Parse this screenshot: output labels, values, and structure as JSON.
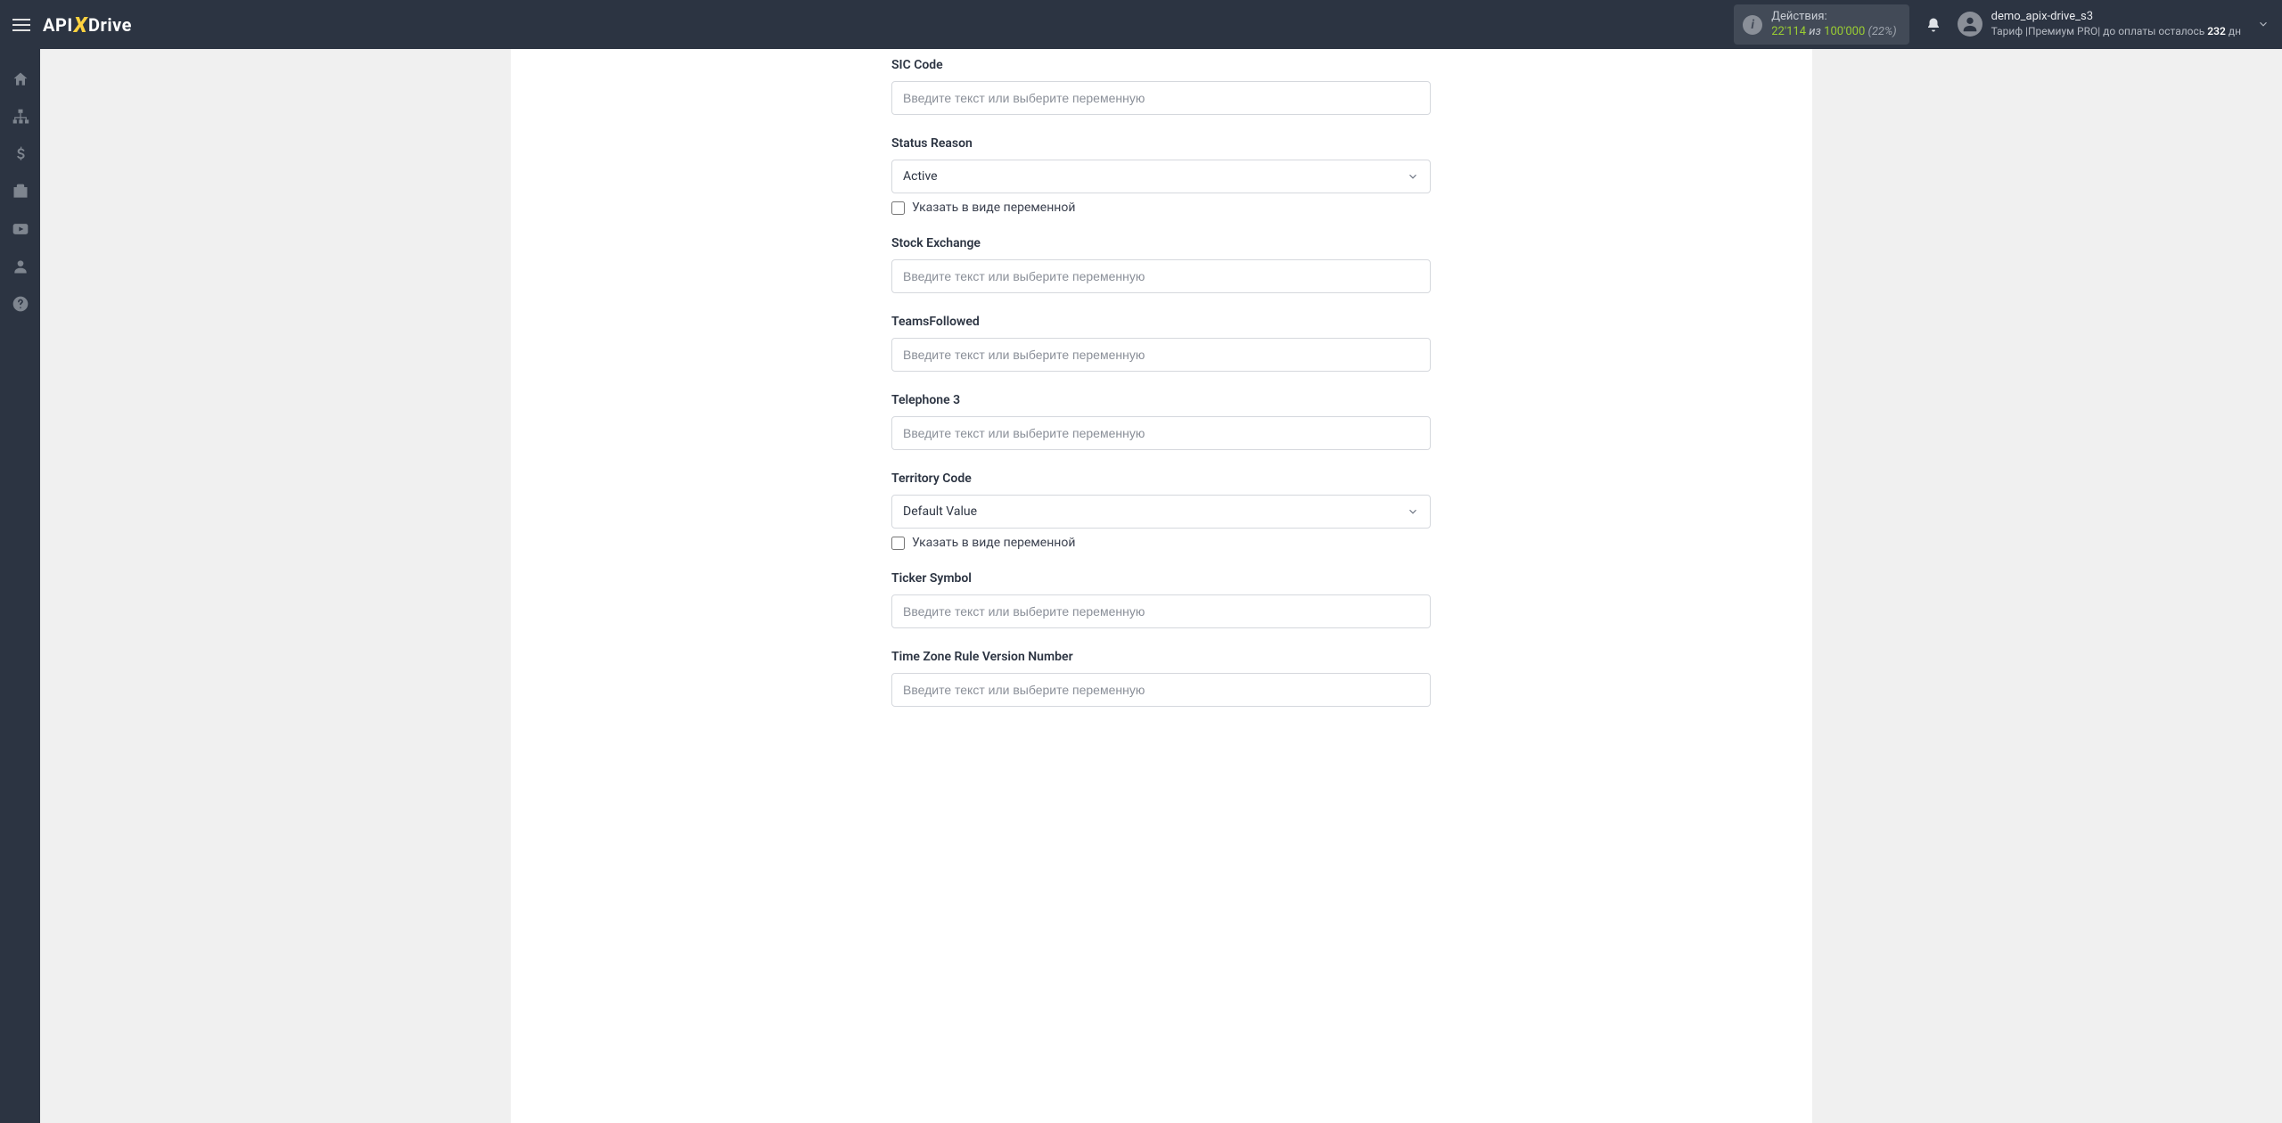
{
  "brand": {
    "part1": "API",
    "x": "X",
    "part2": "Drive"
  },
  "actions": {
    "label": "Действия:",
    "count": "22'114",
    "mid": "из",
    "max": "100'000",
    "pct": "(22%)"
  },
  "user": {
    "name": "demo_apix-drive_s3",
    "tariff_prefix": "Тариф |",
    "tariff_plan": "Премиум PRO",
    "tariff_mid": "| до оплаты осталось ",
    "tariff_days": "232",
    "tariff_suffix": " дн"
  },
  "placeholder_text": "Введите текст или выберите переменную",
  "checkbox_label": "Указать в виде переменной",
  "fields": {
    "sic_code": {
      "label": "SIC Code"
    },
    "status_reason": {
      "label": "Status Reason",
      "value": "Active"
    },
    "stock_exchange": {
      "label": "Stock Exchange"
    },
    "teams_followed": {
      "label": "TeamsFollowed"
    },
    "telephone_3": {
      "label": "Telephone 3"
    },
    "territory_code": {
      "label": "Territory Code",
      "value": "Default Value"
    },
    "ticker_symbol": {
      "label": "Ticker Symbol"
    },
    "tz_rule_version": {
      "label": "Time Zone Rule Version Number"
    }
  }
}
